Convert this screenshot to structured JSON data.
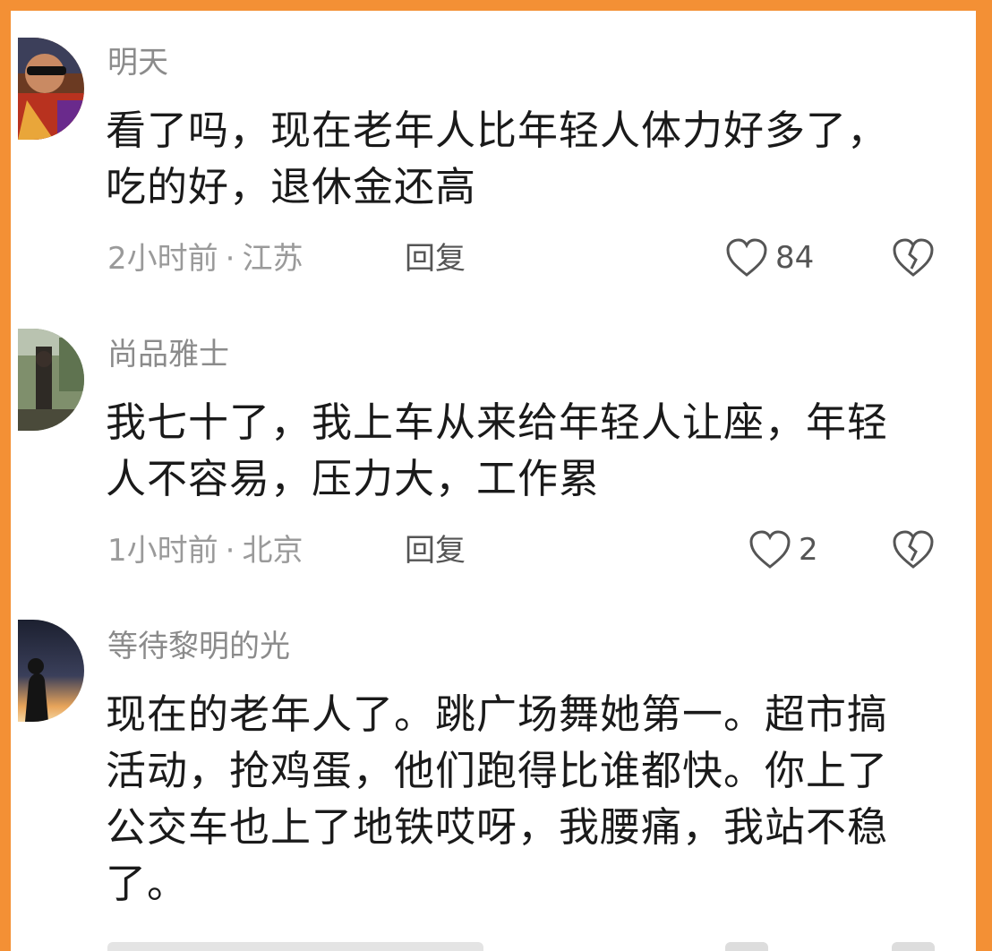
{
  "comments": [
    {
      "username": "明天",
      "text_lines": [
        "看了吗，现在老年人比年轻人体力好多了，",
        "吃的好，退休金还高"
      ],
      "time": "2小时前",
      "location": "江苏",
      "reply_label": "回复",
      "likes": "84",
      "avatar_desc": "person-with-sunglasses"
    },
    {
      "username": "尚品雅士",
      "text_lines": [
        "我七十了，我上车从来给年轻人让座，年轻",
        "人不容易，压力大，工作累"
      ],
      "time": "1小时前",
      "location": "北京",
      "reply_label": "回复",
      "likes": "2",
      "avatar_desc": "outdoor-scene"
    },
    {
      "username": "等待黎明的光",
      "text_lines": [
        "现在的老年人了。跳广场舞她第一。超市搞",
        "活动，抢鸡蛋，他们跑得比谁都快。你上了",
        "公交车也上了地铁哎呀，我腰痛，我站不稳",
        "了。"
      ],
      "avatar_desc": "silhouette-sunset"
    }
  ],
  "colors": {
    "border": "#f39035",
    "username": "#8b8b8b",
    "meta": "#9a9a9a",
    "text": "#1a1a1a",
    "icon": "#555555"
  },
  "separator": "·"
}
